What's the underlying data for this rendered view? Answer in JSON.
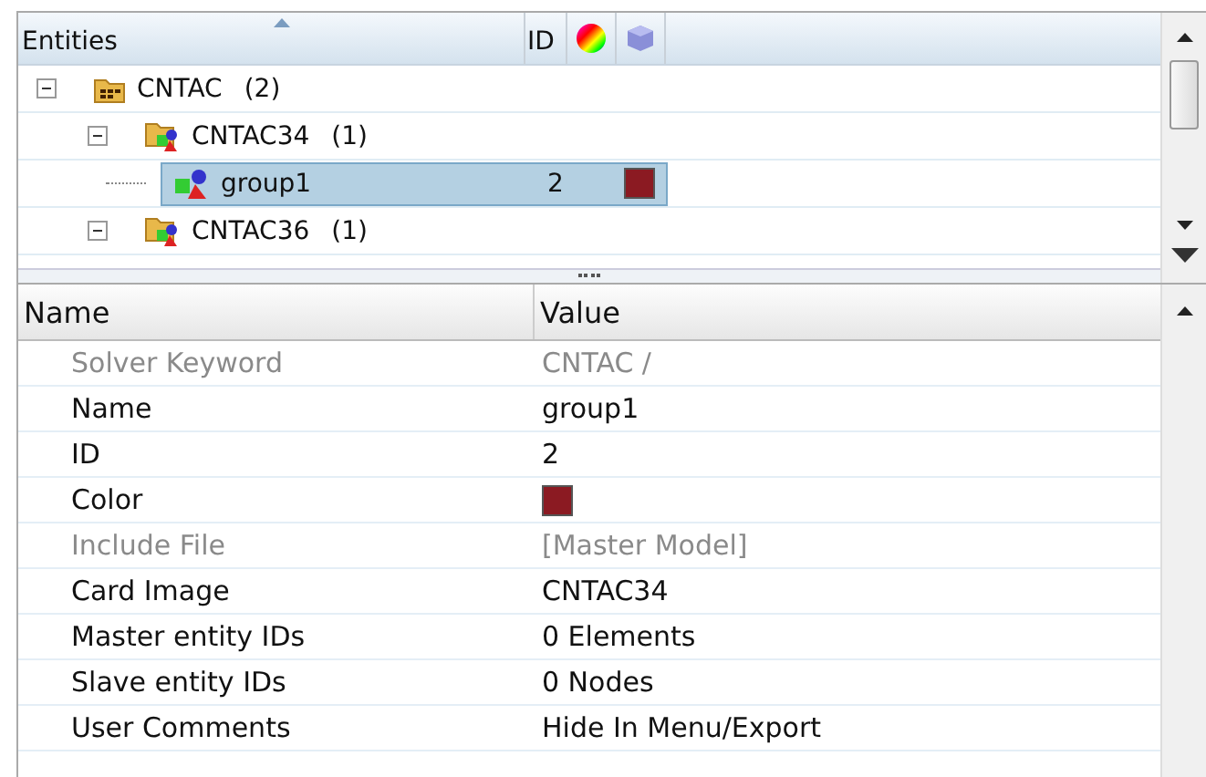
{
  "entity_tree": {
    "columns": [
      "Entities",
      "ID"
    ],
    "items": [
      {
        "label": "CNTAC",
        "count": "(2)",
        "kind": "folder",
        "expanded": true,
        "selected": false,
        "children": [
          {
            "label": "CNTAC34",
            "count": "(1)",
            "kind": "collector",
            "expanded": true,
            "selected": false,
            "children": [
              {
                "label": "group1",
                "kind": "entity",
                "selected": true,
                "id": "2",
                "color": "#8b1a22"
              }
            ]
          },
          {
            "label": "CNTAC36",
            "count": "(1)",
            "kind": "collector",
            "expanded": true,
            "selected": false
          }
        ]
      }
    ]
  },
  "properties": {
    "columns": [
      "Name",
      "Value"
    ],
    "rows": [
      {
        "name": "Solver Keyword",
        "value": "CNTAC /",
        "disabled": true,
        "kind": "text"
      },
      {
        "name": "Name",
        "value": "group1",
        "disabled": false,
        "kind": "text"
      },
      {
        "name": "ID",
        "value": "2",
        "disabled": false,
        "kind": "text"
      },
      {
        "name": "Color",
        "color": "#8b1a22",
        "disabled": false,
        "kind": "color"
      },
      {
        "name": "Include File",
        "value": "[Master Model]",
        "disabled": true,
        "kind": "text"
      },
      {
        "name": "Card Image",
        "value": "CNTAC34",
        "disabled": false,
        "kind": "text"
      },
      {
        "name": "Master entity IDs",
        "value": "0 Elements",
        "disabled": false,
        "kind": "text"
      },
      {
        "name": "Slave entity IDs",
        "value": "0 Nodes",
        "disabled": false,
        "kind": "text"
      },
      {
        "name": "User Comments",
        "value": "Hide In Menu/Export",
        "disabled": false,
        "kind": "text"
      }
    ]
  }
}
